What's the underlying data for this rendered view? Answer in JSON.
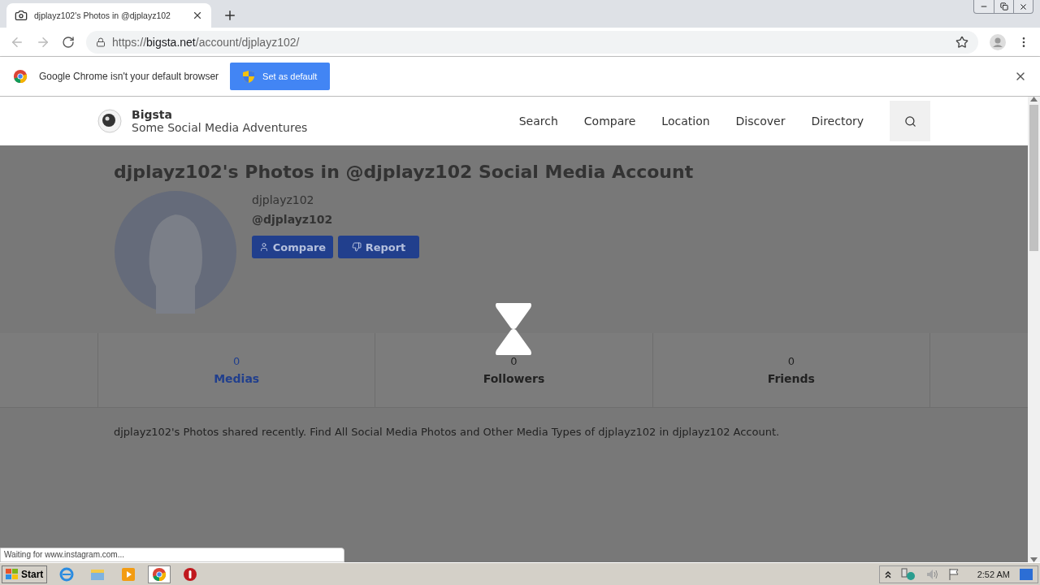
{
  "browser": {
    "tab_title": "djplayz102's Photos in @djplayz102",
    "url_scheme": "https://",
    "url_host": "bigsta.net",
    "url_path": "/account/djplayz102/",
    "infobar_message": "Google Chrome isn't your default browser",
    "infobar_button": "Set as default"
  },
  "site": {
    "brand": "Bigsta",
    "tagline": "Some Social Media Adventures",
    "nav": [
      "Search",
      "Compare",
      "Location",
      "Discover",
      "Directory"
    ],
    "title": "djplayz102's Photos in @djplayz102 Social Media Account",
    "display_name": "djplayz102",
    "handle": "@djplayz102",
    "actions": [
      {
        "kind": "compare",
        "label": "Compare"
      },
      {
        "kind": "report",
        "label": "Report"
      }
    ],
    "stats": [
      {
        "value": "0",
        "label": "Medias",
        "selected": true
      },
      {
        "value": "0",
        "label": "Followers",
        "selected": false
      },
      {
        "value": "0",
        "label": "Friends",
        "selected": false
      }
    ],
    "description": "djplayz102's Photos shared recently. Find All Social Media Photos and Other Media Types of djplayz102 in djplayz102 Account.",
    "loading": true
  },
  "status_text": "Waiting for www.instagram.com...",
  "taskbar": {
    "start": "Start",
    "clock": "2:52 AM"
  }
}
